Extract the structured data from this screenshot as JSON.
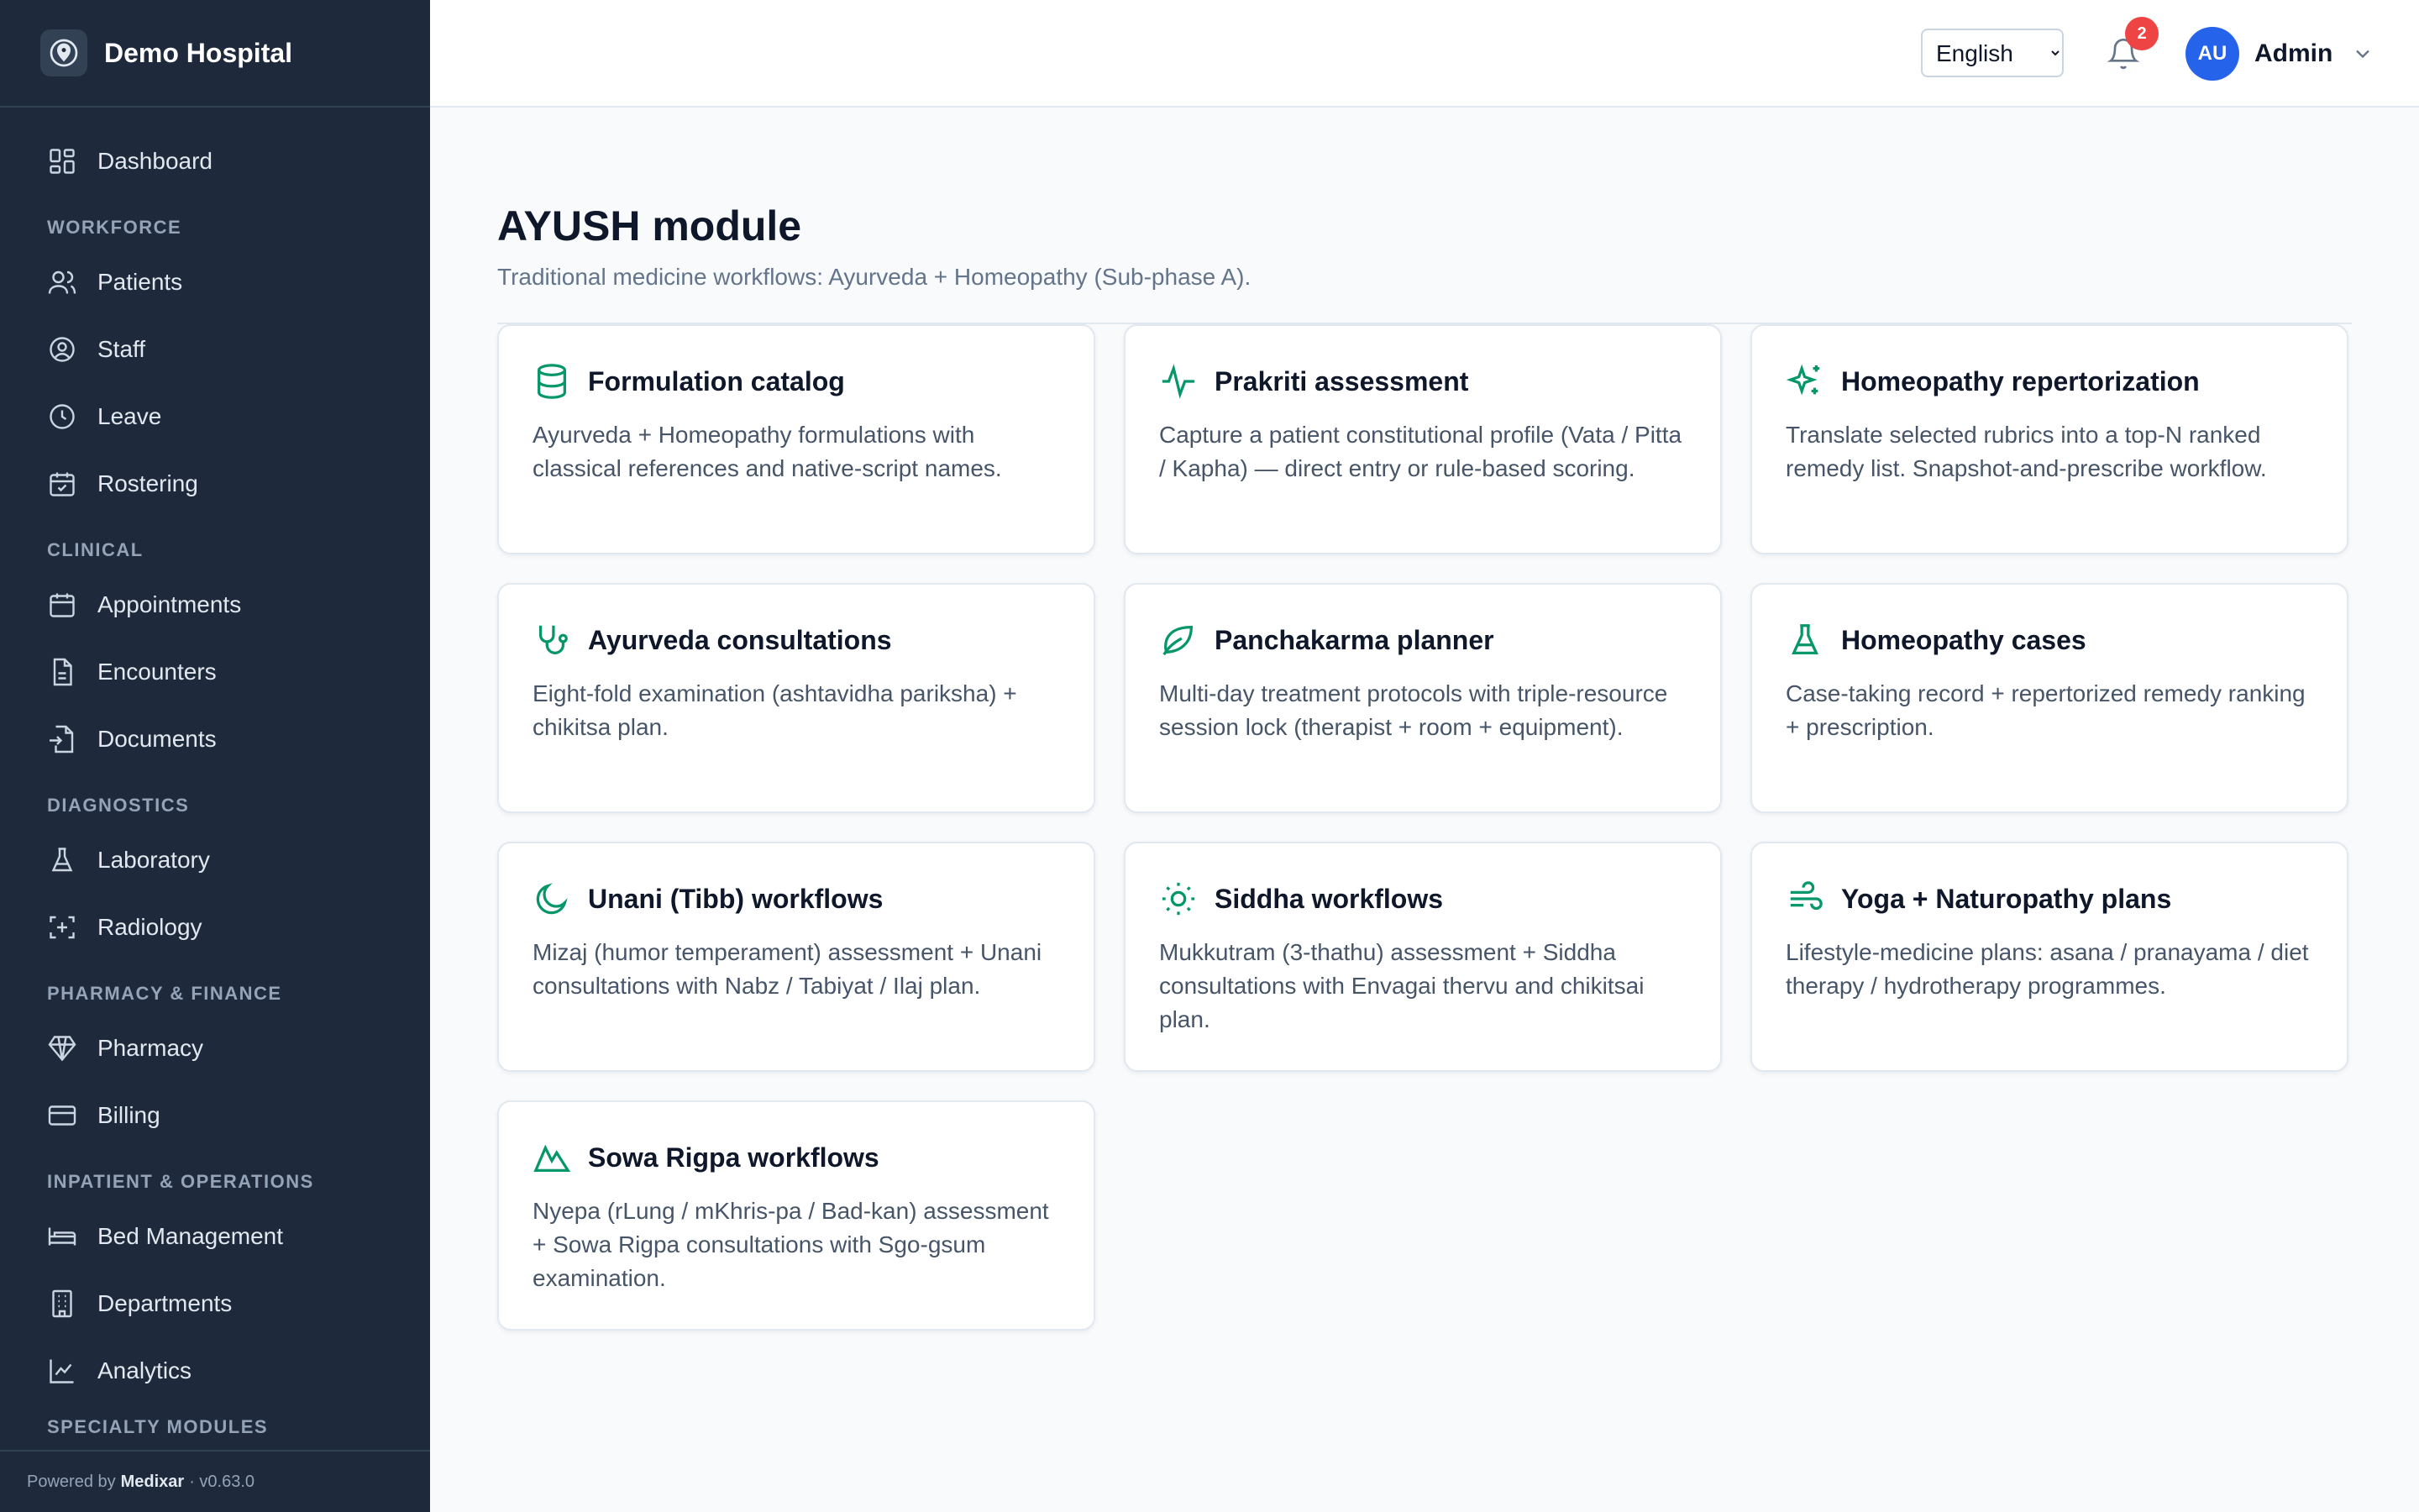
{
  "app": {
    "name": "Demo Hospital",
    "footer_prefix": "Powered by",
    "footer_brand": "Medixar",
    "footer_version": "· v0.63.0"
  },
  "sidebar": {
    "dashboard": {
      "label": "Dashboard",
      "icon": "dashboard-icon"
    },
    "sections": {
      "workforce": "WORKFORCE",
      "clinical": "CLINICAL",
      "diagnostics": "DIAGNOSTICS",
      "pharmacy_finance": "PHARMACY & FINANCE",
      "inpatient_operations": "INPATIENT & OPERATIONS",
      "specialty_modules": "SPECIALTY MODULES"
    },
    "items": {
      "patients": "Patients",
      "staff": "Staff",
      "leave": "Leave",
      "rostering": "Rostering",
      "appointments": "Appointments",
      "encounters": "Encounters",
      "documents": "Documents",
      "laboratory": "Laboratory",
      "radiology": "Radiology",
      "pharmacy": "Pharmacy",
      "billing": "Billing",
      "bed_management": "Bed Management",
      "departments": "Departments",
      "analytics": "Analytics"
    }
  },
  "header": {
    "language": {
      "selected": "English",
      "options": [
        "English"
      ]
    },
    "notifications_count": "2",
    "user_initials": "AU",
    "user_name": "Admin"
  },
  "page": {
    "title": "AYUSH module",
    "subtitle": "Traditional medicine workflows: Ayurveda + Homeopathy (Sub-phase A)."
  },
  "cards": [
    {
      "title": "Formulation catalog",
      "description": "Ayurveda + Homeopathy formulations with classical references and native-script names.",
      "icon": "database-icon"
    },
    {
      "title": "Prakriti assessment",
      "description": "Capture a patient constitutional profile (Vata / Pitta / Kapha) — direct entry or rule-based scoring.",
      "icon": "activity-icon"
    },
    {
      "title": "Homeopathy repertorization",
      "description": "Translate selected rubrics into a top-N ranked remedy list. Snapshot-and-prescribe workflow.",
      "icon": "sparkles-icon"
    },
    {
      "title": "Ayurveda consultations",
      "description": "Eight-fold examination (ashtavidha pariksha) + chikitsa plan.",
      "icon": "stethoscope-icon"
    },
    {
      "title": "Panchakarma planner",
      "description": "Multi-day treatment protocols with triple-resource session lock (therapist + room + equipment).",
      "icon": "leaf-icon"
    },
    {
      "title": "Homeopathy cases",
      "description": "Case-taking record + repertorized remedy ranking + prescription.",
      "icon": "flask-icon"
    },
    {
      "title": "Unani (Tibb) workflows",
      "description": "Mizaj (humor temperament) assessment + Unani consultations with Nabz / Tabiyat / Ilaj plan.",
      "icon": "moon-icon"
    },
    {
      "title": "Siddha workflows",
      "description": "Mukkutram (3-thathu) assessment + Siddha consultations with Envagai thervu and chikitsai plan.",
      "icon": "sun-icon"
    },
    {
      "title": "Yoga + Naturopathy plans",
      "description": "Lifestyle-medicine plans: asana / pranayama / diet therapy / hydrotherapy programmes.",
      "icon": "wind-icon"
    },
    {
      "title": "Sowa Rigpa workflows",
      "description": "Nyepa (rLung / mKhris-pa / Bad-kan) assessment + Sowa Rigpa consultations with Sgo-gsum examination.",
      "icon": "mountain-icon"
    }
  ],
  "colors": {
    "sidebar_bg": "#1e293b",
    "accent_green": "#059669",
    "avatar_blue": "#2563eb",
    "badge_red": "#ef4444"
  }
}
